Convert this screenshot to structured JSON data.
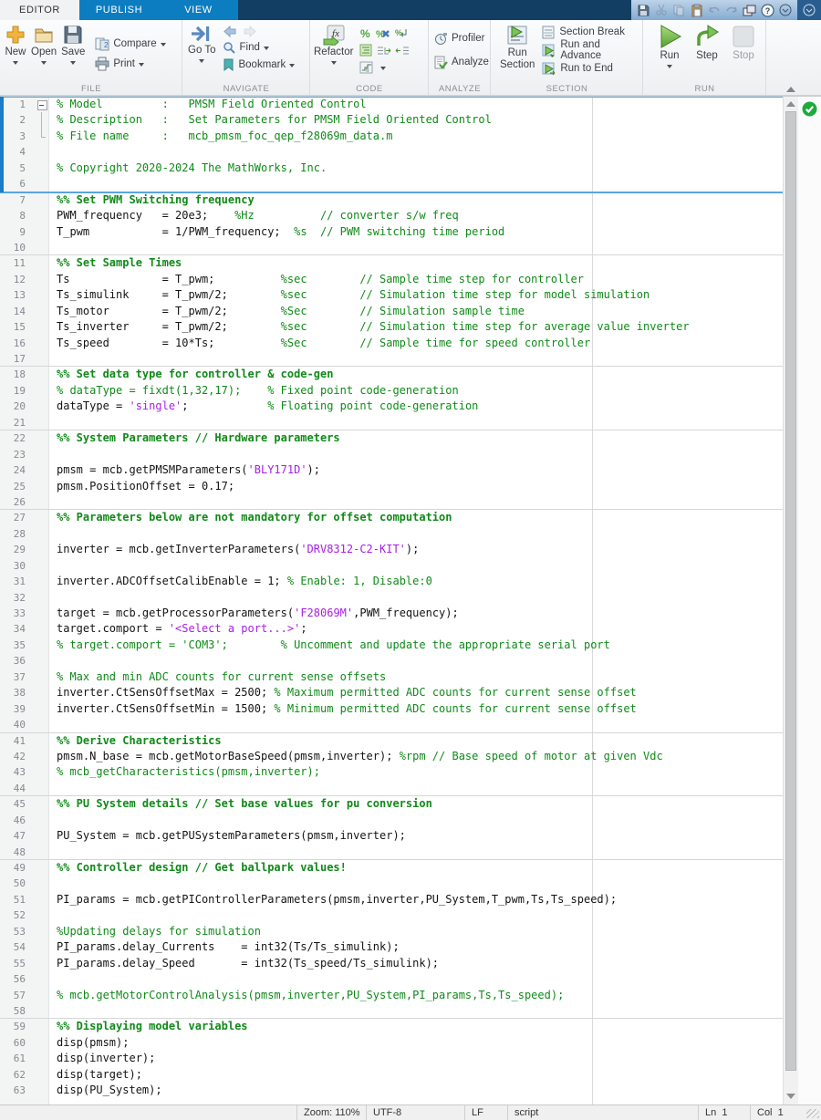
{
  "tabs": {
    "editor": "EDITOR",
    "publish": "PUBLISH",
    "view": "VIEW"
  },
  "quick_access": {
    "icons": [
      "save",
      "cut",
      "copy",
      "paste",
      "undo",
      "redo",
      "windows",
      "help",
      "more"
    ],
    "end_icon": "toolstrip-menu"
  },
  "toolbar": {
    "file": {
      "label": "FILE",
      "new": "New",
      "open": "Open",
      "save": "Save",
      "compare": "Compare",
      "print": "Print"
    },
    "navigate": {
      "label": "NAVIGATE",
      "goto": "Go To",
      "find": "Find",
      "bookmark": "Bookmark"
    },
    "code": {
      "label": "CODE",
      "refactor": "Refactor"
    },
    "analyze": {
      "label": "ANALYZE",
      "profiler": "Profiler",
      "analyze": "Analyze"
    },
    "section": {
      "label": "SECTION",
      "run_section_1": "Run",
      "run_section_2": "Section",
      "section_break": "Section Break",
      "run_advance": "Run and Advance",
      "run_to_end": "Run to End"
    },
    "run": {
      "label": "RUN",
      "run": "Run",
      "step": "Step",
      "stop": "Stop"
    }
  },
  "editor": {
    "code_analyzer": "ok",
    "current_section_lines": [
      1,
      6
    ],
    "lines": [
      {
        "n": 1,
        "fold": "start",
        "div": "blue",
        "s": [
          [
            "c",
            "% Model         :   PMSM Field Oriented Control"
          ]
        ]
      },
      {
        "n": 2,
        "fold": "mid",
        "s": [
          [
            "c",
            "% Description   :   Set Parameters for PMSM Field Oriented Control"
          ]
        ]
      },
      {
        "n": 3,
        "fold": "end",
        "s": [
          [
            "c",
            "% File name     :   mcb_pmsm_foc_qep_f28069m_data.m"
          ]
        ]
      },
      {
        "n": 4,
        "s": []
      },
      {
        "n": 5,
        "s": [
          [
            "c",
            "% Copyright 2020-2024 The MathWorks, Inc."
          ]
        ]
      },
      {
        "n": 6,
        "s": []
      },
      {
        "n": 7,
        "div": "blue",
        "s": [
          [
            "h",
            "%% Set PWM Switching frequency"
          ]
        ]
      },
      {
        "n": 8,
        "s": [
          [
            "k",
            "PWM_frequency   = 20e3;    "
          ],
          [
            "c",
            "%Hz          // converter s/w freq"
          ]
        ]
      },
      {
        "n": 9,
        "s": [
          [
            "k",
            "T_pwm           = 1/PWM_frequency;  "
          ],
          [
            "c",
            "%s  // PWM switching time period"
          ]
        ]
      },
      {
        "n": 10,
        "s": []
      },
      {
        "n": 11,
        "div": "grey",
        "s": [
          [
            "h",
            "%% Set Sample Times"
          ]
        ]
      },
      {
        "n": 12,
        "s": [
          [
            "k",
            "Ts              = T_pwm;          "
          ],
          [
            "c",
            "%sec        // Sample time step for controller"
          ]
        ]
      },
      {
        "n": 13,
        "s": [
          [
            "k",
            "Ts_simulink     = T_pwm/2;        "
          ],
          [
            "c",
            "%sec        // Simulation time step for model simulation"
          ]
        ]
      },
      {
        "n": 14,
        "s": [
          [
            "k",
            "Ts_motor        = T_pwm/2;        "
          ],
          [
            "c",
            "%Sec        // Simulation sample time"
          ]
        ]
      },
      {
        "n": 15,
        "s": [
          [
            "k",
            "Ts_inverter     = T_pwm/2;        "
          ],
          [
            "c",
            "%sec        // Simulation time step for average value inverter"
          ]
        ]
      },
      {
        "n": 16,
        "s": [
          [
            "k",
            "Ts_speed        = 10*Ts;          "
          ],
          [
            "c",
            "%Sec        // Sample time for speed controller"
          ]
        ]
      },
      {
        "n": 17,
        "s": []
      },
      {
        "n": 18,
        "div": "grey",
        "s": [
          [
            "h",
            "%% Set data type for controller & code-gen"
          ]
        ]
      },
      {
        "n": 19,
        "s": [
          [
            "c",
            "% dataType = fixdt(1,32,17);    % Fixed point code-generation"
          ]
        ]
      },
      {
        "n": 20,
        "s": [
          [
            "k",
            "dataType = "
          ],
          [
            "p",
            "'single'"
          ],
          [
            "k",
            ";            "
          ],
          [
            "c",
            "% Floating point code-generation"
          ]
        ]
      },
      {
        "n": 21,
        "s": []
      },
      {
        "n": 22,
        "div": "grey",
        "s": [
          [
            "h",
            "%% System Parameters // Hardware parameters"
          ]
        ]
      },
      {
        "n": 23,
        "s": []
      },
      {
        "n": 24,
        "s": [
          [
            "k",
            "pmsm = mcb.getPMSMParameters("
          ],
          [
            "p",
            "'BLY171D'"
          ],
          [
            "k",
            ");"
          ]
        ]
      },
      {
        "n": 25,
        "s": [
          [
            "k",
            "pmsm.PositionOffset = 0.17;"
          ]
        ]
      },
      {
        "n": 26,
        "s": []
      },
      {
        "n": 27,
        "div": "grey",
        "s": [
          [
            "h",
            "%% Parameters below are not mandatory for offset computation"
          ]
        ]
      },
      {
        "n": 28,
        "s": []
      },
      {
        "n": 29,
        "s": [
          [
            "k",
            "inverter = mcb.getInverterParameters("
          ],
          [
            "p",
            "'DRV8312-C2-KIT'"
          ],
          [
            "k",
            ");"
          ]
        ]
      },
      {
        "n": 30,
        "s": []
      },
      {
        "n": 31,
        "s": [
          [
            "k",
            "inverter.ADCOffsetCalibEnable = 1; "
          ],
          [
            "c",
            "% Enable: 1, Disable:0"
          ]
        ]
      },
      {
        "n": 32,
        "s": []
      },
      {
        "n": 33,
        "s": [
          [
            "k",
            "target = mcb.getProcessorParameters("
          ],
          [
            "p",
            "'F28069M'"
          ],
          [
            "k",
            ",PWM_frequency);"
          ]
        ]
      },
      {
        "n": 34,
        "s": [
          [
            "k",
            "target.comport = "
          ],
          [
            "p",
            "'<Select a port...>'"
          ],
          [
            "k",
            ";"
          ]
        ]
      },
      {
        "n": 35,
        "s": [
          [
            "c",
            "% target.comport = 'COM3';        % Uncomment and update the appropriate serial port"
          ]
        ]
      },
      {
        "n": 36,
        "s": []
      },
      {
        "n": 37,
        "s": [
          [
            "c",
            "% Max and min ADC counts for current sense offsets"
          ]
        ]
      },
      {
        "n": 38,
        "s": [
          [
            "k",
            "inverter.CtSensOffsetMax = 2500; "
          ],
          [
            "c",
            "% Maximum permitted ADC counts for current sense offset"
          ]
        ]
      },
      {
        "n": 39,
        "s": [
          [
            "k",
            "inverter.CtSensOffsetMin = 1500; "
          ],
          [
            "c",
            "% Minimum permitted ADC counts for current sense offset"
          ]
        ]
      },
      {
        "n": 40,
        "s": []
      },
      {
        "n": 41,
        "div": "grey",
        "s": [
          [
            "h",
            "%% Derive Characteristics"
          ]
        ]
      },
      {
        "n": 42,
        "s": [
          [
            "k",
            "pmsm.N_base = mcb.getMotorBaseSpeed(pmsm,inverter); "
          ],
          [
            "c",
            "%rpm // Base speed of motor at given Vdc"
          ]
        ]
      },
      {
        "n": 43,
        "s": [
          [
            "c",
            "% mcb_getCharacteristics(pmsm,inverter);"
          ]
        ]
      },
      {
        "n": 44,
        "s": []
      },
      {
        "n": 45,
        "div": "grey",
        "s": [
          [
            "h",
            "%% PU System details // Set base values for pu conversion"
          ]
        ]
      },
      {
        "n": 46,
        "s": []
      },
      {
        "n": 47,
        "s": [
          [
            "k",
            "PU_System = mcb.getPUSystemParameters(pmsm,inverter);"
          ]
        ]
      },
      {
        "n": 48,
        "s": []
      },
      {
        "n": 49,
        "div": "grey",
        "s": [
          [
            "h",
            "%% Controller design // Get ballpark values!"
          ]
        ]
      },
      {
        "n": 50,
        "s": []
      },
      {
        "n": 51,
        "s": [
          [
            "k",
            "PI_params = mcb.getPIControllerParameters(pmsm,inverter,PU_System,T_pwm,Ts,Ts_speed);"
          ]
        ]
      },
      {
        "n": 52,
        "s": []
      },
      {
        "n": 53,
        "s": [
          [
            "c",
            "%Updating delays for simulation"
          ]
        ]
      },
      {
        "n": 54,
        "s": [
          [
            "k",
            "PI_params.delay_Currents    = int32(Ts/Ts_simulink);"
          ]
        ]
      },
      {
        "n": 55,
        "s": [
          [
            "k",
            "PI_params.delay_Speed       = int32(Ts_speed/Ts_simulink);"
          ]
        ]
      },
      {
        "n": 56,
        "s": []
      },
      {
        "n": 57,
        "s": [
          [
            "c",
            "% mcb.getMotorControlAnalysis(pmsm,inverter,PU_System,PI_params,Ts,Ts_speed);"
          ]
        ]
      },
      {
        "n": 58,
        "s": []
      },
      {
        "n": 59,
        "div": "grey",
        "s": [
          [
            "h",
            "%% Displaying model variables"
          ]
        ]
      },
      {
        "n": 60,
        "s": [
          [
            "k",
            "disp(pmsm);"
          ]
        ]
      },
      {
        "n": 61,
        "s": [
          [
            "k",
            "disp(inverter);"
          ]
        ]
      },
      {
        "n": 62,
        "s": [
          [
            "k",
            "disp(target);"
          ]
        ]
      },
      {
        "n": 63,
        "s": [
          [
            "k",
            "disp(PU_System);"
          ]
        ]
      }
    ]
  },
  "status": {
    "zoom": "Zoom: 110%",
    "encoding": "UTF-8",
    "eol": "LF",
    "type": "script",
    "line": "Ln  1",
    "col": "Col  1"
  },
  "colors": {
    "tab_blue": "#0d7dc1",
    "tab_dark": "#123e64",
    "comment_green": "#108a19",
    "string_purple": "#a81ce8",
    "section_blue": "#1b7cc9",
    "run_green": "#5cab38",
    "analyzer_ok_green": "#1faa3c"
  }
}
